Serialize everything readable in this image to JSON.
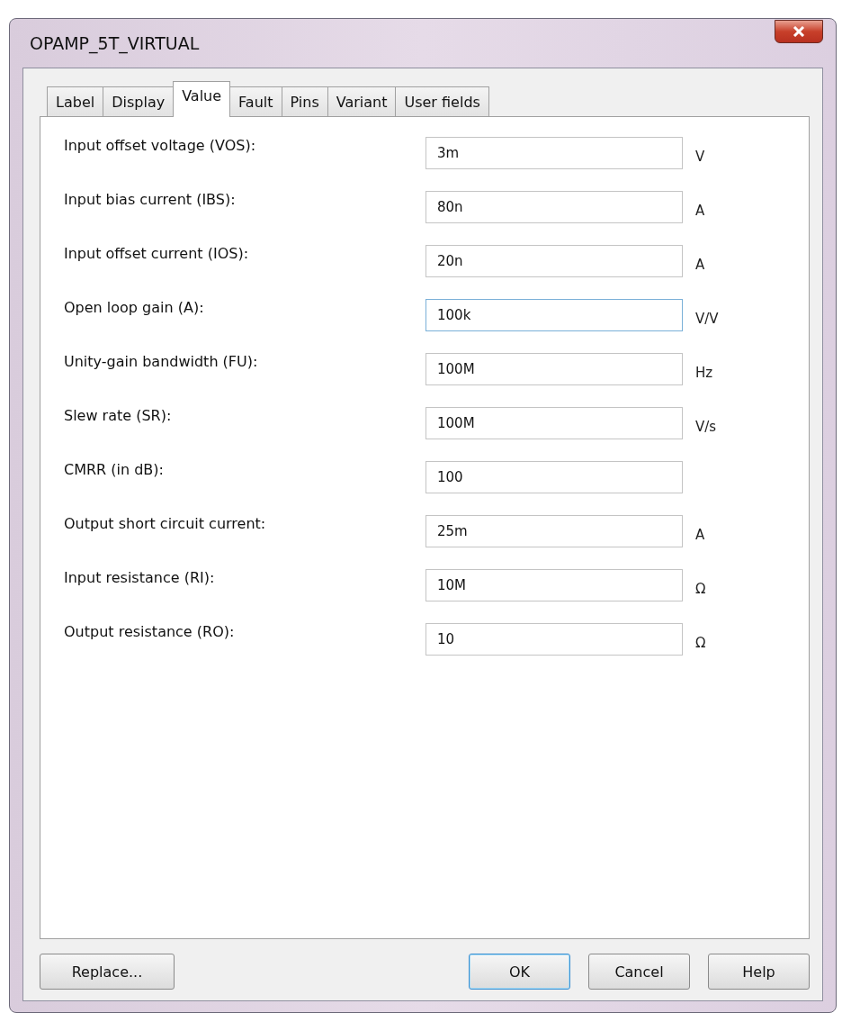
{
  "window": {
    "title": "OPAMP_5T_VIRTUAL"
  },
  "tabs": [
    {
      "label": "Label",
      "selected": false
    },
    {
      "label": "Display",
      "selected": false
    },
    {
      "label": "Value",
      "selected": true
    },
    {
      "label": "Fault",
      "selected": false
    },
    {
      "label": "Pins",
      "selected": false
    },
    {
      "label": "Variant",
      "selected": false
    },
    {
      "label": "User fields",
      "selected": false
    }
  ],
  "parameters": [
    {
      "label": "Input offset voltage (VOS):",
      "value": "3m",
      "unit": "V",
      "focused": false
    },
    {
      "label": "Input bias current (IBS):",
      "value": "80n",
      "unit": "A",
      "focused": false
    },
    {
      "label": "Input offset current (IOS):",
      "value": "20n",
      "unit": "A",
      "focused": false
    },
    {
      "label": "Open loop gain (A):",
      "value": "100k",
      "unit": "V/V",
      "focused": true
    },
    {
      "label": "Unity-gain bandwidth (FU):",
      "value": "100M",
      "unit": "Hz",
      "focused": false
    },
    {
      "label": "Slew rate (SR):",
      "value": "100M",
      "unit": "V/s",
      "focused": false
    },
    {
      "label": "CMRR (in dB):",
      "value": "100",
      "focused": false
    },
    {
      "label": "Output short circuit current:",
      "value": "25m",
      "unit": "A",
      "focused": false
    },
    {
      "label": "Input resistance (RI):",
      "value": "10M",
      "unit": "Ω",
      "focused": false
    },
    {
      "label": "Output resistance (RO):",
      "value": "10",
      "unit": "Ω",
      "focused": false
    }
  ],
  "buttons": {
    "left": "Replace...",
    "right": [
      {
        "label": "OK",
        "default": true
      },
      {
        "label": "Cancel",
        "default": false
      },
      {
        "label": "Help",
        "default": false
      }
    ]
  }
}
